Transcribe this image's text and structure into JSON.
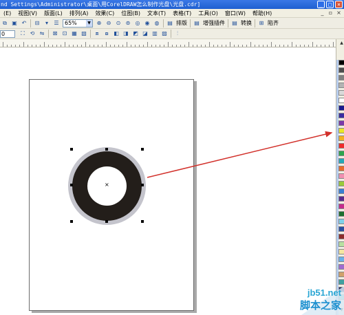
{
  "window": {
    "title": "nd Settings\\Administrator\\桌面\\用CorelDRAW怎么制作光盘\\光盘.cdr]",
    "minimize": "_",
    "maximize": "□",
    "close": "×"
  },
  "menubar": {
    "items": [
      "(E)",
      "视图(V)",
      "版面(L)",
      "排列(A)",
      "效果(C)",
      "位图(B)",
      "文本(T)",
      "表格(T)",
      "工具(O)",
      "窗口(W)",
      "帮助(H)"
    ],
    "mdi_min": "_",
    "mdi_restore": "▫",
    "mdi_close": "×"
  },
  "toolbar": {
    "zoom": "65%",
    "zoom_arrow": "▼",
    "label_layout": "排版",
    "label_enhance": "增强插件",
    "label_convert": "转换",
    "label_align": "陷齐"
  },
  "propertybar": {
    "x_value": "0"
  },
  "canvas": {
    "center_mark": "×"
  },
  "palette": {
    "scroll_up": "▲",
    "scroll_down": "▼",
    "colors": [
      "#000000",
      "#4d4d4d",
      "#808080",
      "#b3b3b3",
      "#d9d9d9",
      "#ffffff",
      "#1a1a8c",
      "#3b2ca0",
      "#7a3aa8",
      "#e8e826",
      "#f2b21f",
      "#ef2b2b",
      "#2da44e",
      "#25a8b8",
      "#e86a2b",
      "#f08fb0",
      "#9ac93a",
      "#3a7fd0",
      "#5a2b8c",
      "#c42b8c",
      "#1f6f2f",
      "#7fd0e8",
      "#2b4fa0",
      "#8c2b2b",
      "#b8e0a0",
      "#f5e6a0",
      "#6bb0e8",
      "#a06bd0",
      "#d0a06b",
      "#40a0a0",
      "#202060",
      "#60c0c0"
    ]
  },
  "watermark": {
    "url": "jb51.net",
    "name": "脚本之家"
  },
  "colors": {
    "titlebar": "#1f5fd0",
    "ring_outer": "#c4c4cc",
    "ring_fill": "#231e1a",
    "arrow": "#d2312b"
  }
}
